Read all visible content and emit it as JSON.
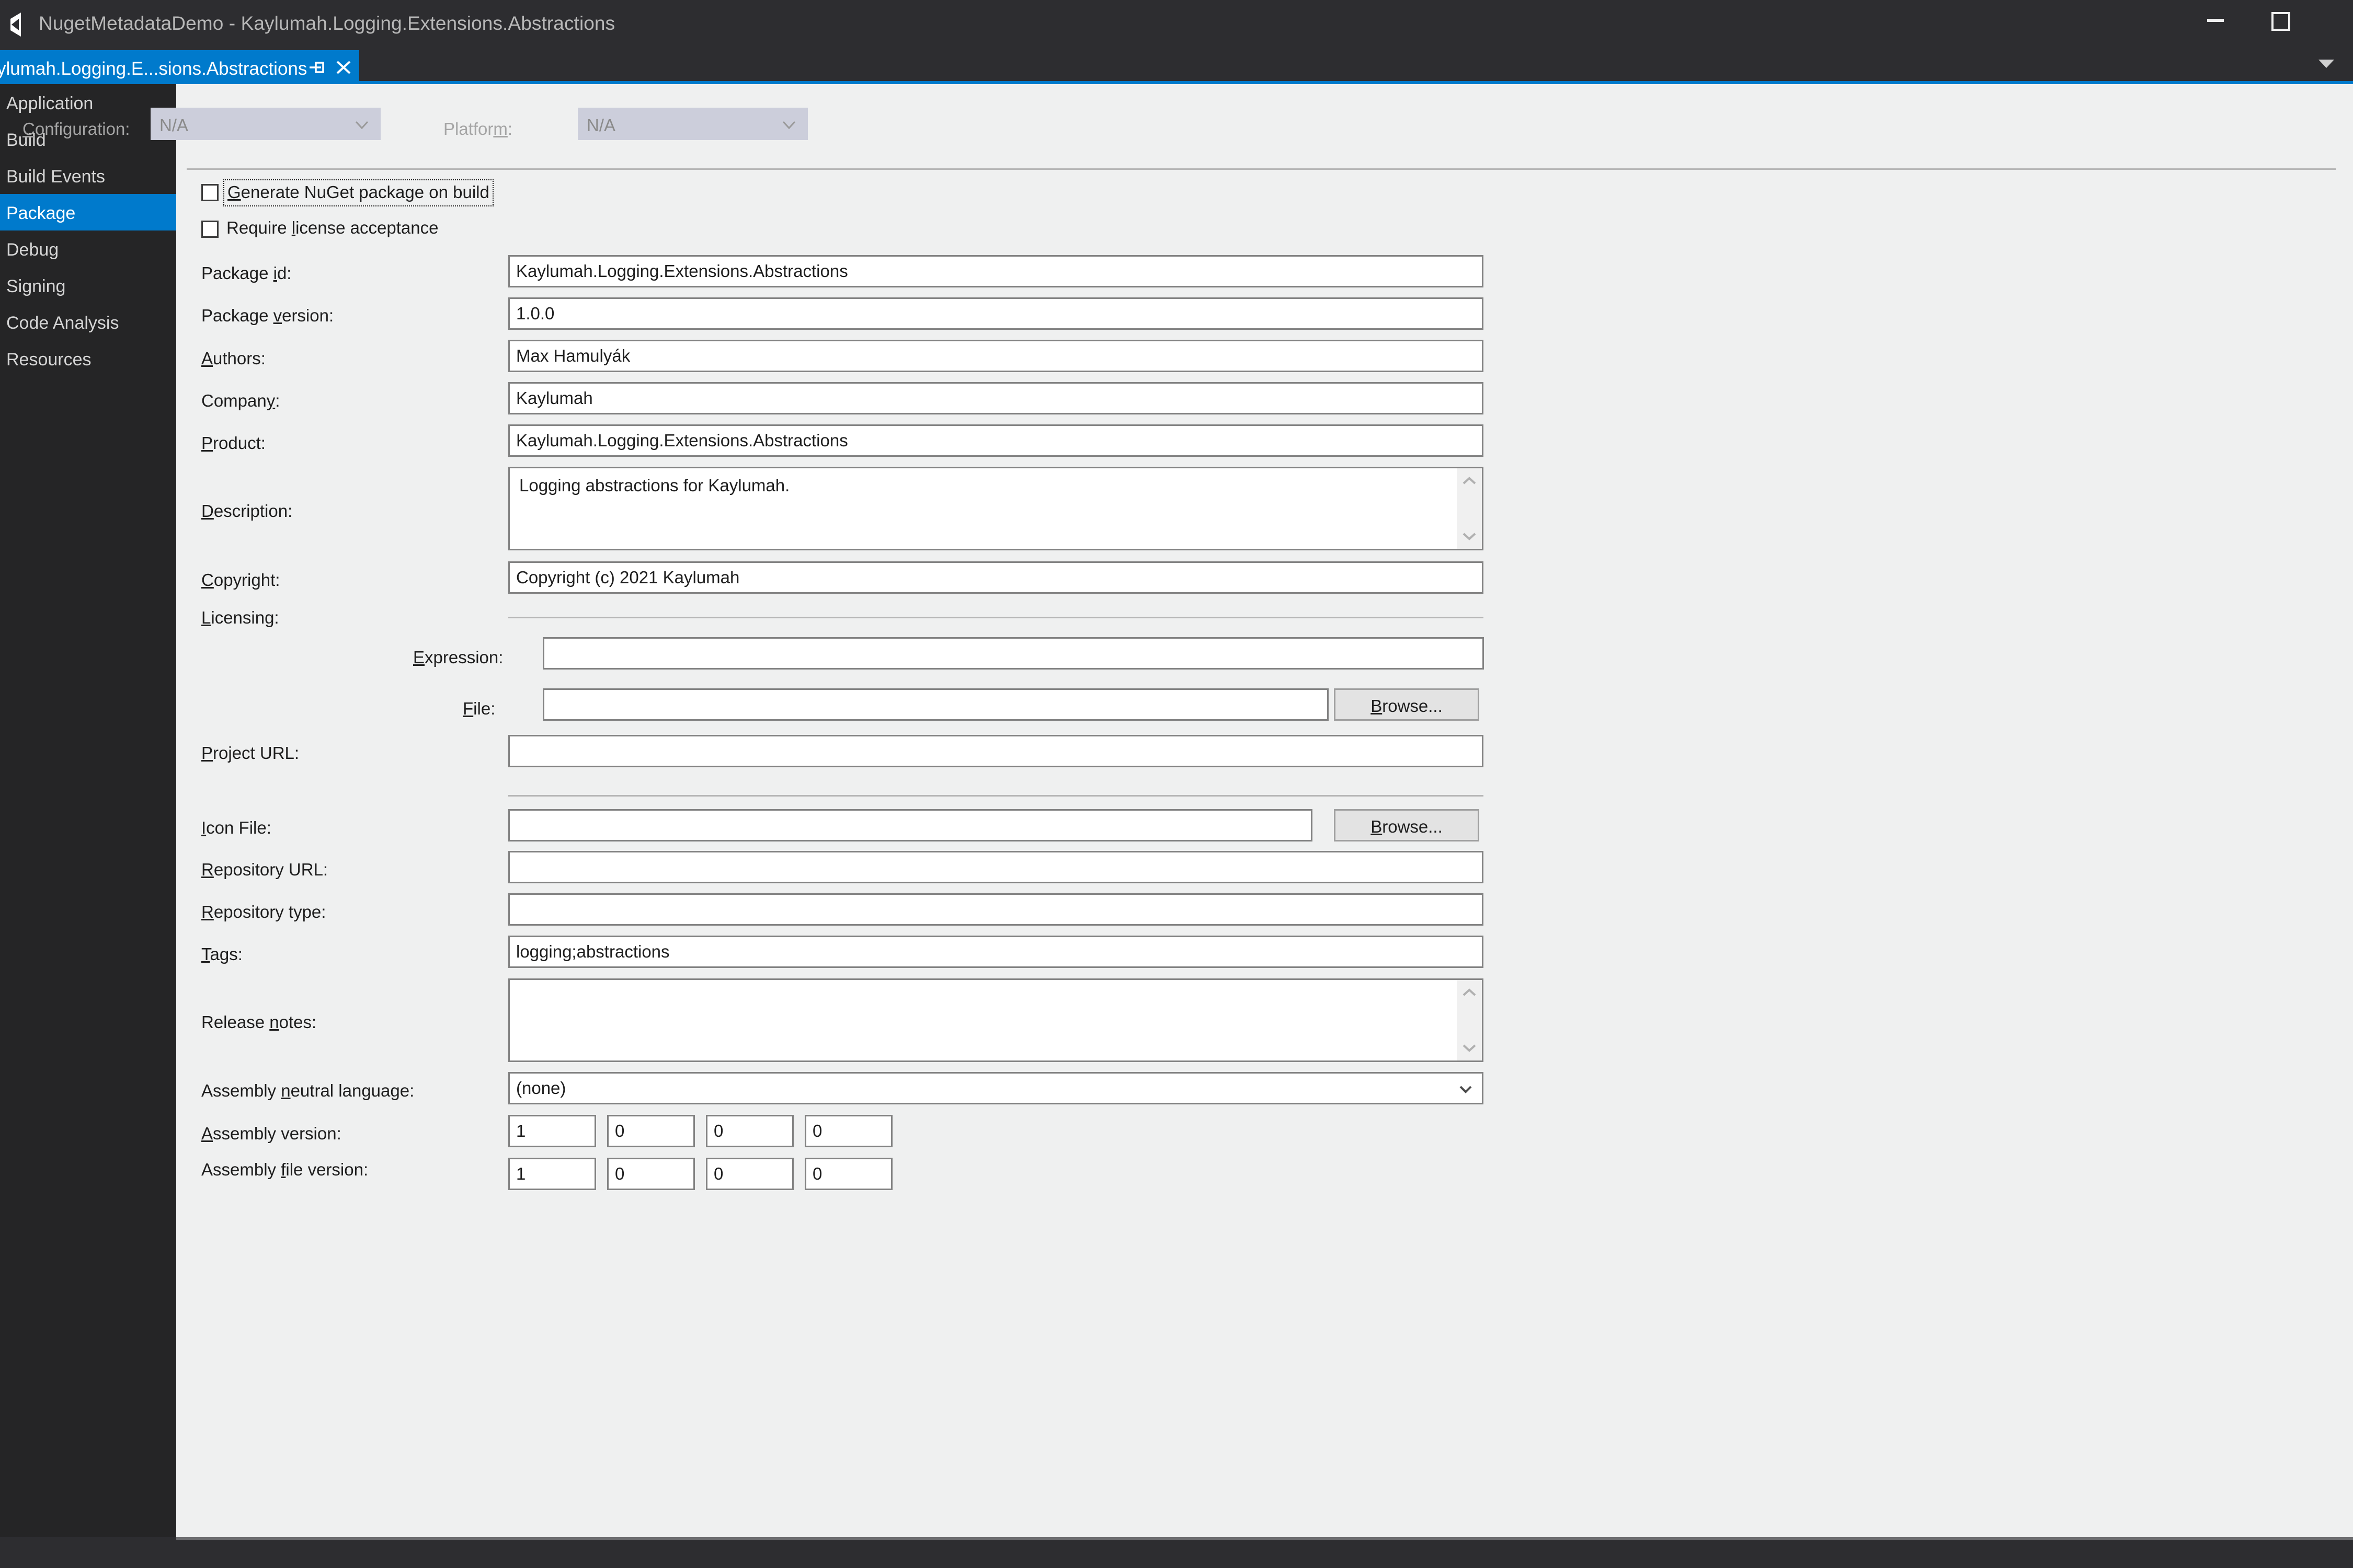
{
  "window": {
    "title": "NugetMetadataDemo - Kaylumah.Logging.Extensions.Abstractions",
    "app_icon": "visual-studio-icon",
    "minimize_label": "Minimize",
    "maximize_label": "Maximize"
  },
  "tab": {
    "label": "ylumah.Logging.E...sions.Abstractions",
    "pin_icon": "pin-icon",
    "close_icon": "close-icon",
    "overflow_icon": "chevron-down-icon"
  },
  "sidebar": {
    "items": [
      {
        "label": "Application",
        "selected": false
      },
      {
        "label": "Build",
        "selected": false
      },
      {
        "label": "Build Events",
        "selected": false
      },
      {
        "label": "Package",
        "selected": true
      },
      {
        "label": "Debug",
        "selected": false
      },
      {
        "label": "Signing",
        "selected": false
      },
      {
        "label": "Code Analysis",
        "selected": false
      },
      {
        "label": "Resources",
        "selected": false
      }
    ]
  },
  "toolbar": {
    "configuration_label": "Configuration:",
    "configuration_value": "N/A",
    "platform_label": "Platform:",
    "platform_value": "N/A"
  },
  "checkboxes": [
    {
      "label": "Generate NuGet package on build",
      "checked": false,
      "focused": true
    },
    {
      "label": "Require license acceptance",
      "checked": false,
      "focused": false
    }
  ],
  "fields": {
    "package_id": {
      "label": "Package id:",
      "value": "Kaylumah.Logging.Extensions.Abstractions"
    },
    "package_version": {
      "label": "Package version:",
      "value": "1.0.0"
    },
    "authors": {
      "label": "Authors:",
      "value": "Max Hamulyák"
    },
    "company": {
      "label": "Company:",
      "value": "Kaylumah"
    },
    "product": {
      "label": "Product:",
      "value": "Kaylumah.Logging.Extensions.Abstractions"
    },
    "description": {
      "label": "Description:",
      "value": "Logging abstractions for Kaylumah."
    },
    "copyright": {
      "label": "Copyright:",
      "value": "Copyright (c) 2021 Kaylumah"
    },
    "licensing": {
      "label": "Licensing:"
    },
    "license_expression": {
      "label": "Expression:",
      "value": "",
      "selected": false
    },
    "license_file": {
      "label": "File:",
      "value": "",
      "selected": false,
      "browse_label": "Browse..."
    },
    "project_url": {
      "label": "Project URL:",
      "value": ""
    },
    "icon_file": {
      "label": "Icon File:",
      "value": "",
      "browse_label": "Browse..."
    },
    "repository_url": {
      "label": "Repository URL:",
      "value": ""
    },
    "repository_type": {
      "label": "Repository type:",
      "value": ""
    },
    "tags": {
      "label": "Tags:",
      "value": "logging;abstractions"
    },
    "release_notes": {
      "label": "Release notes:",
      "value": ""
    },
    "assembly_neutral_language": {
      "label": "Assembly neutral language:",
      "value": "(none)"
    },
    "assembly_version": {
      "label": "Assembly version:",
      "parts": [
        "1",
        "0",
        "0",
        "0"
      ]
    },
    "assembly_file_version": {
      "label": "Assembly file version:",
      "parts": [
        "1",
        "0",
        "0",
        "0"
      ]
    }
  },
  "colors": {
    "accent": "#007acc",
    "titlebar_bg": "#2d2d30",
    "sidebar_bg": "#252526",
    "content_bg": "#eff0f0",
    "field_border": "#828282"
  }
}
